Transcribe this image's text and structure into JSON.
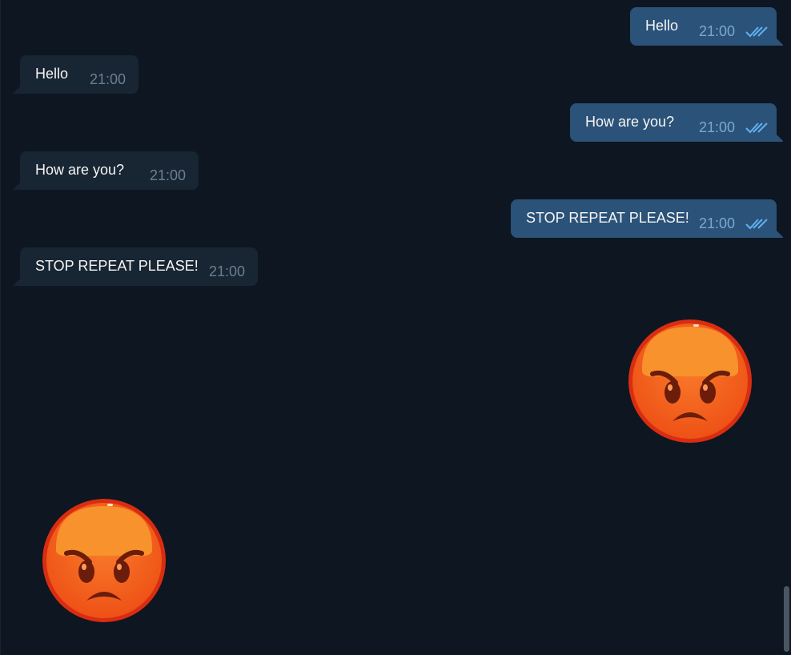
{
  "colors": {
    "background": "#0e1621",
    "incoming_bubble": "#182533",
    "outgoing_bubble": "#2b5278",
    "read_ticks": "#5fb0f0"
  },
  "messages": [
    {
      "direction": "out",
      "text": "Hello",
      "time": "21:00",
      "status": "read"
    },
    {
      "direction": "in",
      "text": "Hello",
      "time": "21:00"
    },
    {
      "direction": "out",
      "text": "How are you?",
      "time": "21:00",
      "status": "read"
    },
    {
      "direction": "in",
      "text": "How are you?",
      "time": "21:00"
    },
    {
      "direction": "out",
      "text": "STOP REPEAT PLEASE!",
      "time": "21:00",
      "status": "read"
    },
    {
      "direction": "in",
      "text": "STOP REPEAT PLEASE!",
      "time": "21:00"
    }
  ],
  "stickers": [
    {
      "direction": "out",
      "icon": "angry-face-emoji"
    },
    {
      "direction": "in",
      "icon": "angry-face-emoji"
    }
  ]
}
